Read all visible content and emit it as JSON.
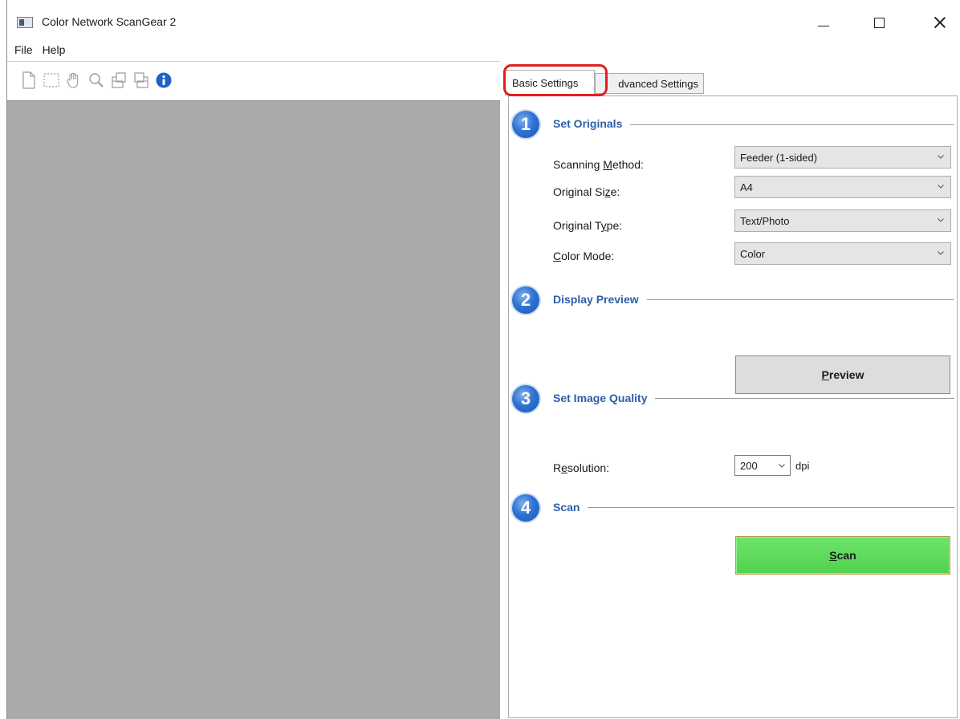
{
  "window": {
    "title": "Color Network ScanGear 2"
  },
  "menu": {
    "file": "File",
    "help": "Help"
  },
  "toolbar": {
    "icons": [
      "new-page-icon",
      "selection-icon",
      "hand-icon",
      "zoom-icon",
      "rotate-left-icon",
      "rotate-right-icon",
      "info-icon"
    ]
  },
  "tabs": {
    "basic": "Basic Settings",
    "advanced": "Advanced Settings",
    "advanced_visible": "dvanced Settings",
    "active": "basic",
    "highlight_color": "#e0201f"
  },
  "sections": {
    "s1": {
      "number": "1",
      "title": "Set Originals"
    },
    "s2": {
      "number": "2",
      "title": "Display Preview"
    },
    "s3": {
      "number": "3",
      "title": "Set Image Quality"
    },
    "s4": {
      "number": "4",
      "title": "Scan"
    }
  },
  "fields": {
    "scanning_method": {
      "label_pre": "Scanning ",
      "label_key": "M",
      "label_post": "ethod:",
      "value": "Feeder (1-sided)"
    },
    "original_size": {
      "label_pre": "Original Si",
      "label_key": "z",
      "label_post": "e:",
      "value": "A4"
    },
    "original_type": {
      "label_pre": "Original T",
      "label_key": "y",
      "label_post": "pe:",
      "value": "Text/Photo"
    },
    "color_mode": {
      "label_pre": "",
      "label_key": "C",
      "label_post": "olor Mode:",
      "value": "Color"
    },
    "resolution": {
      "label_pre": "R",
      "label_key": "e",
      "label_post": "solution:",
      "value": "200",
      "unit": "dpi"
    }
  },
  "buttons": {
    "preview_key": "P",
    "preview_rest": "review",
    "scan_key": "S",
    "scan_rest": "can"
  },
  "colors": {
    "accent": "#2d5fa8",
    "scan_button": "#5cd959",
    "preview_bg": "#aaaaaa"
  }
}
